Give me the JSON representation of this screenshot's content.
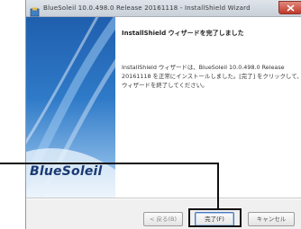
{
  "window": {
    "title": "BlueSoleil 10.0.498.0 Release 20161118 - InstallShield Wizard"
  },
  "brand": {
    "logo_text": "BlueSoleil",
    "banner_color": "#2f7ac8",
    "logo_color": "#1a3a73"
  },
  "content": {
    "heading": "InstallShield ウィザードを完了しました",
    "body_lines": [
      "InstallShield ウィザードは、BlueSoleil 10.0.498.0 Release",
      "20161118 を正常にインストールしました。[完了] をクリックして、",
      "ウィザードを終了してください。"
    ]
  },
  "buttons": {
    "back": "< 戻る(B)",
    "finish": "完了(F)",
    "cancel": "キャンセル"
  },
  "icons": {
    "title": "installer-icon",
    "close": "close-icon"
  }
}
